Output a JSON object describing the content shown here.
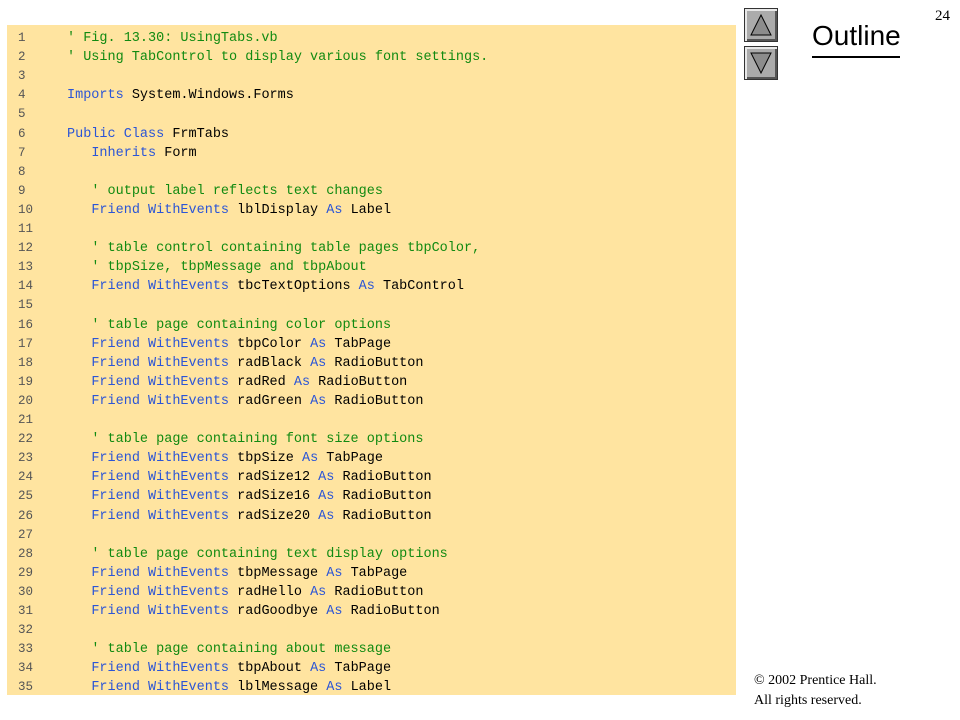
{
  "slide": {
    "number": "24",
    "outline_label": "Outline",
    "copyright_line1": "© 2002 Prentice Hall.",
    "copyright_line2": "All rights reserved."
  },
  "nav": {
    "up_icon": "triangle-up-icon",
    "down_icon": "triangle-down-icon"
  },
  "colors": {
    "panel_bg": "#ffe4a0",
    "keyword": "#2b55d6",
    "comment": "#118a11",
    "text": "#000000"
  },
  "code_lines": [
    {
      "n": "1",
      "parts": [
        {
          "t": "' Fig. 13.30: UsingTabs.vb",
          "c": "cm"
        }
      ]
    },
    {
      "n": "2",
      "parts": [
        {
          "t": "' Using TabControl to display various font settings.",
          "c": "cm"
        }
      ]
    },
    {
      "n": "3",
      "parts": []
    },
    {
      "n": "4",
      "parts": [
        {
          "t": "Imports",
          "c": "kw"
        },
        {
          "t": " System.Windows.Forms",
          "c": ""
        }
      ]
    },
    {
      "n": "5",
      "parts": []
    },
    {
      "n": "6",
      "parts": [
        {
          "t": "Public Class",
          "c": "kw"
        },
        {
          "t": " FrmTabs",
          "c": ""
        }
      ]
    },
    {
      "n": "7",
      "parts": [
        {
          "t": "   ",
          "c": ""
        },
        {
          "t": "Inherits",
          "c": "kw"
        },
        {
          "t": " Form",
          "c": ""
        }
      ]
    },
    {
      "n": "8",
      "parts": []
    },
    {
      "n": "9",
      "parts": [
        {
          "t": "   ",
          "c": ""
        },
        {
          "t": "' output label reflects text changes",
          "c": "cm"
        }
      ]
    },
    {
      "n": "10",
      "parts": [
        {
          "t": "   ",
          "c": ""
        },
        {
          "t": "Friend WithEvents",
          "c": "kw"
        },
        {
          "t": " lblDisplay ",
          "c": ""
        },
        {
          "t": "As",
          "c": "kw"
        },
        {
          "t": " Label",
          "c": ""
        }
      ]
    },
    {
      "n": "11",
      "parts": []
    },
    {
      "n": "12",
      "parts": [
        {
          "t": "   ",
          "c": ""
        },
        {
          "t": "' table control containing table pages tbpColor,",
          "c": "cm"
        }
      ]
    },
    {
      "n": "13",
      "parts": [
        {
          "t": "   ",
          "c": ""
        },
        {
          "t": "' tbpSize, tbpMessage and tbpAbout",
          "c": "cm"
        }
      ]
    },
    {
      "n": "14",
      "parts": [
        {
          "t": "   ",
          "c": ""
        },
        {
          "t": "Friend WithEvents",
          "c": "kw"
        },
        {
          "t": " tbcTextOptions ",
          "c": ""
        },
        {
          "t": "As",
          "c": "kw"
        },
        {
          "t": " TabControl",
          "c": ""
        }
      ]
    },
    {
      "n": "15",
      "parts": []
    },
    {
      "n": "16",
      "parts": [
        {
          "t": "   ",
          "c": ""
        },
        {
          "t": "' table page containing color options",
          "c": "cm"
        }
      ]
    },
    {
      "n": "17",
      "parts": [
        {
          "t": "   ",
          "c": ""
        },
        {
          "t": "Friend WithEvents",
          "c": "kw"
        },
        {
          "t": " tbpColor ",
          "c": ""
        },
        {
          "t": "As",
          "c": "kw"
        },
        {
          "t": " TabPage",
          "c": ""
        }
      ]
    },
    {
      "n": "18",
      "parts": [
        {
          "t": "   ",
          "c": ""
        },
        {
          "t": "Friend WithEvents",
          "c": "kw"
        },
        {
          "t": " radBlack ",
          "c": ""
        },
        {
          "t": "As",
          "c": "kw"
        },
        {
          "t": " RadioButton",
          "c": ""
        }
      ]
    },
    {
      "n": "19",
      "parts": [
        {
          "t": "   ",
          "c": ""
        },
        {
          "t": "Friend WithEvents",
          "c": "kw"
        },
        {
          "t": " radRed ",
          "c": ""
        },
        {
          "t": "As",
          "c": "kw"
        },
        {
          "t": " RadioButton",
          "c": ""
        }
      ]
    },
    {
      "n": "20",
      "parts": [
        {
          "t": "   ",
          "c": ""
        },
        {
          "t": "Friend WithEvents",
          "c": "kw"
        },
        {
          "t": " radGreen ",
          "c": ""
        },
        {
          "t": "As",
          "c": "kw"
        },
        {
          "t": " RadioButton",
          "c": ""
        }
      ]
    },
    {
      "n": "21",
      "parts": []
    },
    {
      "n": "22",
      "parts": [
        {
          "t": "   ",
          "c": ""
        },
        {
          "t": "' table page containing font size options",
          "c": "cm"
        }
      ]
    },
    {
      "n": "23",
      "parts": [
        {
          "t": "   ",
          "c": ""
        },
        {
          "t": "Friend WithEvents",
          "c": "kw"
        },
        {
          "t": " tbpSize ",
          "c": ""
        },
        {
          "t": "As",
          "c": "kw"
        },
        {
          "t": " TabPage",
          "c": ""
        }
      ]
    },
    {
      "n": "24",
      "parts": [
        {
          "t": "   ",
          "c": ""
        },
        {
          "t": "Friend WithEvents",
          "c": "kw"
        },
        {
          "t": " radSize12 ",
          "c": ""
        },
        {
          "t": "As",
          "c": "kw"
        },
        {
          "t": " RadioButton",
          "c": ""
        }
      ]
    },
    {
      "n": "25",
      "parts": [
        {
          "t": "   ",
          "c": ""
        },
        {
          "t": "Friend WithEvents",
          "c": "kw"
        },
        {
          "t": " radSize16 ",
          "c": ""
        },
        {
          "t": "As",
          "c": "kw"
        },
        {
          "t": " RadioButton",
          "c": ""
        }
      ]
    },
    {
      "n": "26",
      "parts": [
        {
          "t": "   ",
          "c": ""
        },
        {
          "t": "Friend WithEvents",
          "c": "kw"
        },
        {
          "t": " radSize20 ",
          "c": ""
        },
        {
          "t": "As",
          "c": "kw"
        },
        {
          "t": " RadioButton",
          "c": ""
        }
      ]
    },
    {
      "n": "27",
      "parts": []
    },
    {
      "n": "28",
      "parts": [
        {
          "t": "   ",
          "c": ""
        },
        {
          "t": "' table page containing text display options",
          "c": "cm"
        }
      ]
    },
    {
      "n": "29",
      "parts": [
        {
          "t": "   ",
          "c": ""
        },
        {
          "t": "Friend WithEvents",
          "c": "kw"
        },
        {
          "t": " tbpMessage ",
          "c": ""
        },
        {
          "t": "As",
          "c": "kw"
        },
        {
          "t": " TabPage",
          "c": ""
        }
      ]
    },
    {
      "n": "30",
      "parts": [
        {
          "t": "   ",
          "c": ""
        },
        {
          "t": "Friend WithEvents",
          "c": "kw"
        },
        {
          "t": " radHello ",
          "c": ""
        },
        {
          "t": "As",
          "c": "kw"
        },
        {
          "t": " RadioButton",
          "c": ""
        }
      ]
    },
    {
      "n": "31",
      "parts": [
        {
          "t": "   ",
          "c": ""
        },
        {
          "t": "Friend WithEvents",
          "c": "kw"
        },
        {
          "t": " radGoodbye ",
          "c": ""
        },
        {
          "t": "As",
          "c": "kw"
        },
        {
          "t": " RadioButton",
          "c": ""
        }
      ]
    },
    {
      "n": "32",
      "parts": []
    },
    {
      "n": "33",
      "parts": [
        {
          "t": "   ",
          "c": ""
        },
        {
          "t": "' table page containing about message",
          "c": "cm"
        }
      ]
    },
    {
      "n": "34",
      "parts": [
        {
          "t": "   ",
          "c": ""
        },
        {
          "t": "Friend WithEvents",
          "c": "kw"
        },
        {
          "t": " tbpAbout ",
          "c": ""
        },
        {
          "t": "As",
          "c": "kw"
        },
        {
          "t": " TabPage",
          "c": ""
        }
      ]
    },
    {
      "n": "35",
      "parts": [
        {
          "t": "   ",
          "c": ""
        },
        {
          "t": "Friend WithEvents",
          "c": "kw"
        },
        {
          "t": " lblMessage ",
          "c": ""
        },
        {
          "t": "As",
          "c": "kw"
        },
        {
          "t": " Label",
          "c": ""
        }
      ]
    }
  ]
}
